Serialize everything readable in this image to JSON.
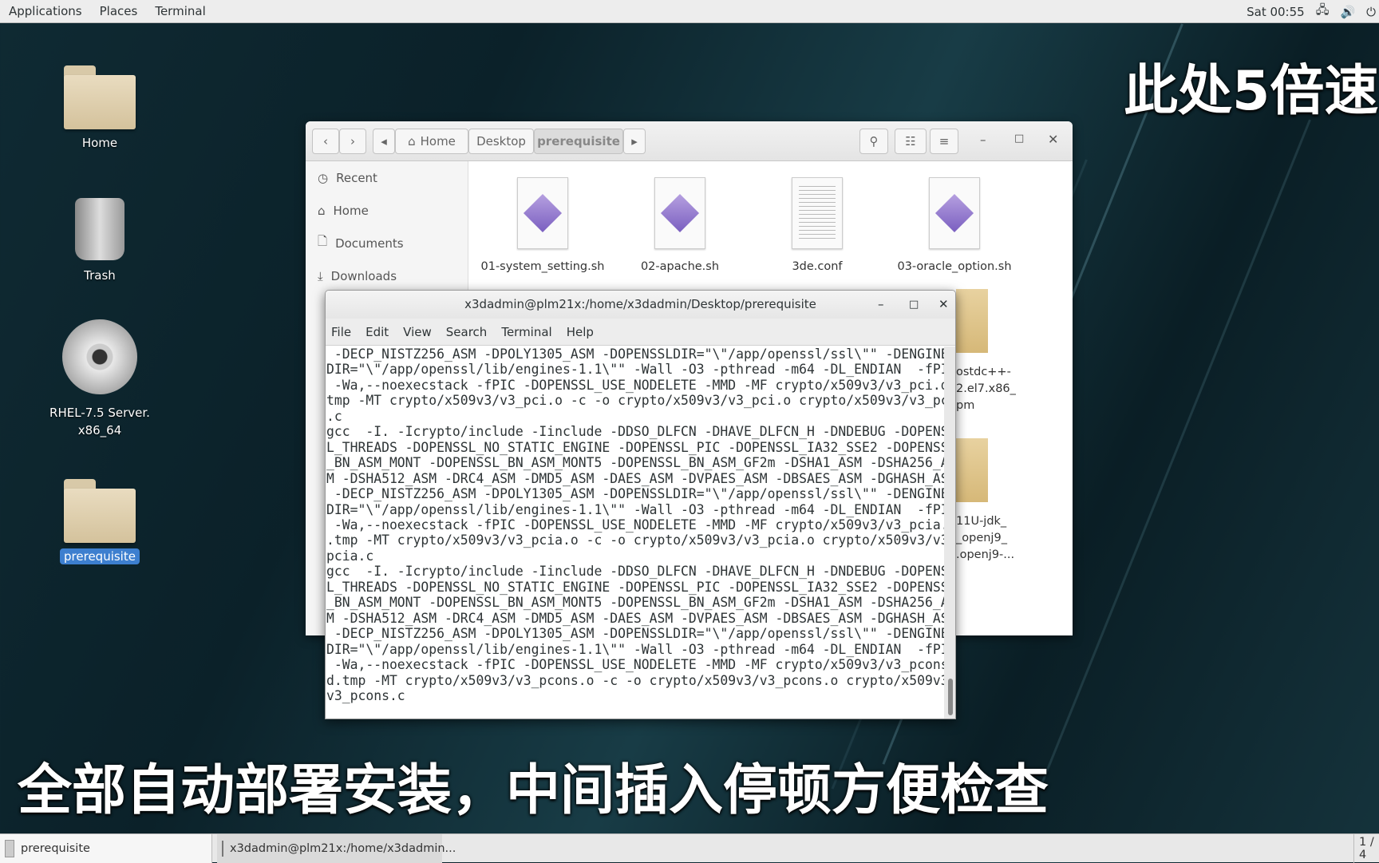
{
  "topbar": {
    "menus": [
      "Applications",
      "Places",
      "Terminal"
    ],
    "clock": "Sat 00:55"
  },
  "desktop": {
    "icons": [
      "Home",
      "Trash",
      "RHEL-7.5 Server.\nx86_64",
      "prerequisite"
    ]
  },
  "file_manager": {
    "path": [
      "Home",
      "Desktop",
      "prerequisite"
    ],
    "sidebar": [
      "Recent",
      "Home",
      "Documents",
      "Downloads"
    ],
    "files": [
      "01-system_setting.sh",
      "02-apache.sh",
      "3de.conf",
      "03-oracle_option.sh"
    ],
    "partial_files": [
      "ostdc++-\n2.el7.x86_\npm",
      "11U-jdk_\n_openj9_\n.openj9-..."
    ]
  },
  "terminal": {
    "title": "x3dadmin@plm21x:/home/x3dadmin/Desktop/prerequisite",
    "menu": [
      "File",
      "Edit",
      "View",
      "Search",
      "Terminal",
      "Help"
    ],
    "output": " -DECP_NISTZ256_ASM -DPOLY1305_ASM -DOPENSSLDIR=\"\\\"/app/openssl/ssl\\\"\" -DENGINES\nDIR=\"\\\"/app/openssl/lib/engines-1.1\\\"\" -Wall -O3 -pthread -m64 -DL_ENDIAN  -fPIC\n -Wa,--noexecstack -fPIC -DOPENSSL_USE_NODELETE -MMD -MF crypto/x509v3/v3_pci.d.\ntmp -MT crypto/x509v3/v3_pci.o -c -o crypto/x509v3/v3_pci.o crypto/x509v3/v3_pci\n.c\ngcc  -I. -Icrypto/include -Iinclude -DDSO_DLFCN -DHAVE_DLFCN_H -DNDEBUG -DOPENSS\nL_THREADS -DOPENSSL_NO_STATIC_ENGINE -DOPENSSL_PIC -DOPENSSL_IA32_SSE2 -DOPENSSL\n_BN_ASM_MONT -DOPENSSL_BN_ASM_MONT5 -DOPENSSL_BN_ASM_GF2m -DSHA1_ASM -DSHA256_AS\nM -DSHA512_ASM -DRC4_ASM -DMD5_ASM -DAES_ASM -DVPAES_ASM -DBSAES_ASM -DGHASH_ASM\n -DECP_NISTZ256_ASM -DPOLY1305_ASM -DOPENSSLDIR=\"\\\"/app/openssl/ssl\\\"\" -DENGINES\nDIR=\"\\\"/app/openssl/lib/engines-1.1\\\"\" -Wall -O3 -pthread -m64 -DL_ENDIAN  -fPIC\n -Wa,--noexecstack -fPIC -DOPENSSL_USE_NODELETE -MMD -MF crypto/x509v3/v3_pcia.d\n.tmp -MT crypto/x509v3/v3_pcia.o -c -o crypto/x509v3/v3_pcia.o crypto/x509v3/v3_\npcia.c\ngcc  -I. -Icrypto/include -Iinclude -DDSO_DLFCN -DHAVE_DLFCN_H -DNDEBUG -DOPENSS\nL_THREADS -DOPENSSL_NO_STATIC_ENGINE -DOPENSSL_PIC -DOPENSSL_IA32_SSE2 -DOPENSSL\n_BN_ASM_MONT -DOPENSSL_BN_ASM_MONT5 -DOPENSSL_BN_ASM_GF2m -DSHA1_ASM -DSHA256_AS\nM -DSHA512_ASM -DRC4_ASM -DMD5_ASM -DAES_ASM -DVPAES_ASM -DBSAES_ASM -DGHASH_ASM\n -DECP_NISTZ256_ASM -DPOLY1305_ASM -DOPENSSLDIR=\"\\\"/app/openssl/ssl\\\"\" -DENGINES\nDIR=\"\\\"/app/openssl/lib/engines-1.1\\\"\" -Wall -O3 -pthread -m64 -DL_ENDIAN  -fPIC\n -Wa,--noexecstack -fPIC -DOPENSSL_USE_NODELETE -MMD -MF crypto/x509v3/v3_pcons.\nd.tmp -MT crypto/x509v3/v3_pcons.o -c -o crypto/x509v3/v3_pcons.o crypto/x509v3/\nv3_pcons.c"
  },
  "captions": {
    "top": "此处5倍速",
    "bottom": "全部自动部署安装，中间插入停顿方便检查"
  },
  "taskbar": {
    "items": [
      "prerequisite",
      "x3dadmin@plm21x:/home/x3dadmin..."
    ],
    "workspace": "1 / 4"
  }
}
